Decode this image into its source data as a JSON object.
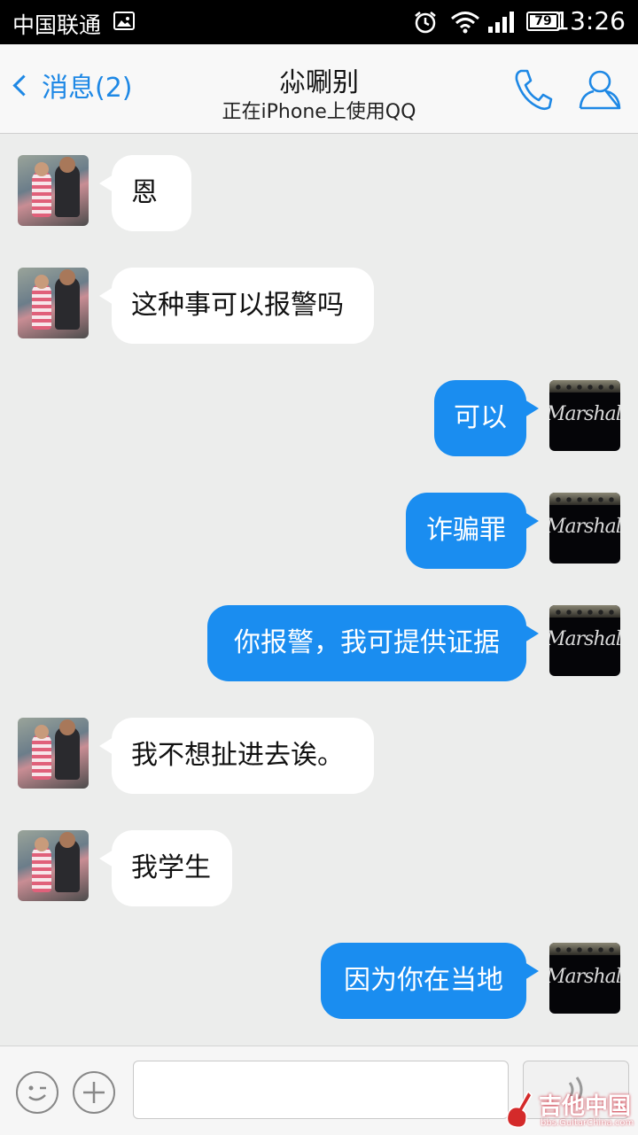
{
  "status_bar": {
    "carrier": "中国联通",
    "battery": "79",
    "time": "13:26"
  },
  "header": {
    "back_label": "消息(2)",
    "title": "尛唰别",
    "subtitle": "正在iPhone上使用QQ"
  },
  "messages": [
    {
      "from": "other",
      "text": "恩"
    },
    {
      "from": "other",
      "text": "这种事可以报警吗"
    },
    {
      "from": "me",
      "text": "可以"
    },
    {
      "from": "me",
      "text": "诈骗罪"
    },
    {
      "from": "me",
      "text": "你报警，我可提供证据"
    },
    {
      "from": "other",
      "text": "我不想扯进去诶。"
    },
    {
      "from": "other",
      "text": "我学生"
    },
    {
      "from": "me",
      "text": "因为你在当地"
    }
  ],
  "me_avatar_logo": "Marshall",
  "input": {
    "value": "",
    "placeholder": ""
  },
  "watermark": {
    "text": "吉他中国",
    "sub": "bbs.GuitarChina.com"
  },
  "colors": {
    "accent": "#1e88e5",
    "outgoing_bubble": "#1a8df0",
    "incoming_bubble": "#ffffff",
    "background": "#ecedec"
  }
}
